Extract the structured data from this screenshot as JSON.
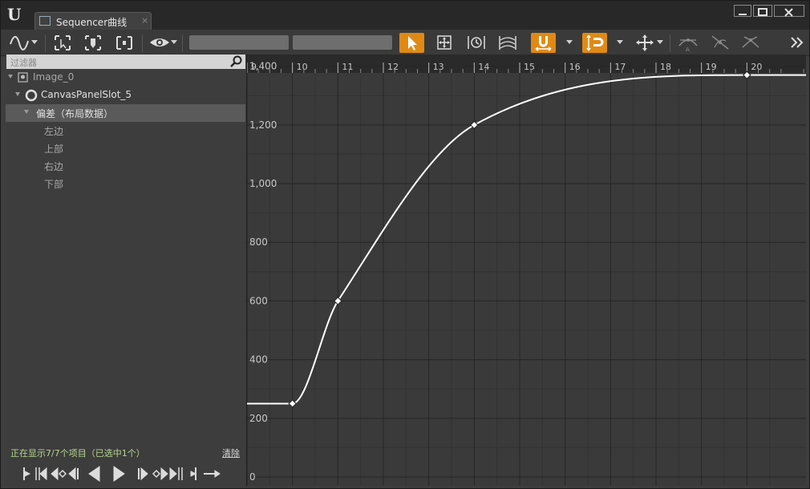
{
  "window": {
    "tab_title": "Sequencer曲线",
    "tab_close": "×"
  },
  "filter": {
    "placeholder": "过滤器"
  },
  "tree": [
    {
      "label": "Image_0",
      "level": 0,
      "icon": "image-icon"
    },
    {
      "label": "CanvasPanelSlot_5",
      "level": 1,
      "icon": "circle-icon"
    },
    {
      "label": "偏差（布局数据）",
      "level": 2,
      "selected": true
    },
    {
      "label": "左边",
      "level": 3
    },
    {
      "label": "上部",
      "level": 3
    },
    {
      "label": "右边",
      "level": 3
    },
    {
      "label": "下部",
      "level": 3
    }
  ],
  "status": {
    "text": "正在显示7/7个项目（已选中1个）",
    "clear_label": "清除"
  },
  "ruler": {
    "labels": [
      "9",
      "10",
      "11",
      "12",
      "13",
      "14",
      "15",
      "16",
      "17",
      "18",
      "19",
      "20"
    ]
  },
  "y_axis": {
    "labels": [
      "1,400",
      "1,200",
      "1,000",
      "800",
      "600",
      "400",
      "200",
      "0"
    ]
  },
  "chart_data": {
    "type": "line",
    "x": [
      10,
      11,
      14,
      20
    ],
    "y": [
      250,
      600,
      1200,
      1370
    ],
    "xlim": [
      9,
      21.3
    ],
    "ylim": [
      -30,
      1440
    ],
    "x_ticks": [
      9,
      10,
      11,
      12,
      13,
      14,
      15,
      16,
      17,
      18,
      19,
      20
    ],
    "y_ticks": [
      0,
      200,
      400,
      600,
      800,
      1000,
      1200,
      1400
    ],
    "grid": true,
    "curve_color": "#ffffff",
    "key_color": "#ffffff"
  },
  "colors": {
    "accent": "#e08a15",
    "status_text": "#b7d68e"
  }
}
